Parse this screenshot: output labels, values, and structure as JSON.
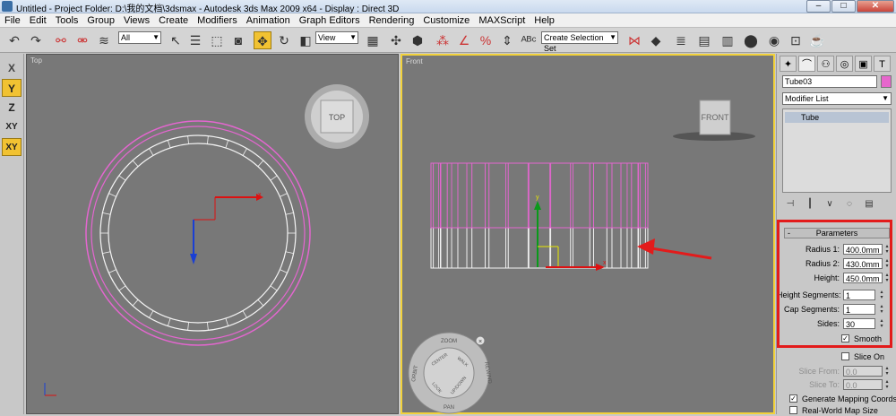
{
  "window": {
    "title": "Untitled      - Project Folder: D:\\我的文档\\3dsmax      - Autodesk 3ds Max  2009 x64      - Display : Direct 3D",
    "minimize": "–",
    "maximize": "□",
    "close": "✕"
  },
  "menu": [
    "File",
    "Edit",
    "Tools",
    "Group",
    "Views",
    "Create",
    "Modifiers",
    "Animation",
    "Graph Editors",
    "Rendering",
    "Customize",
    "MAXScript",
    "Help"
  ],
  "toolbar": {
    "selection_filter": "All",
    "reference_coord": "View",
    "named_selection_placeholder": "Create Selection Set"
  },
  "axis_constraints": [
    "X",
    "Y",
    "Z",
    "XY",
    "XY"
  ],
  "viewports": {
    "top": {
      "label": "Top",
      "viewcube": "TOP"
    },
    "front": {
      "label": "Front",
      "viewcube": "FRONT"
    }
  },
  "steering_wheel": {
    "zoom": "ZOOM",
    "orbit": "ORBIT",
    "center": "CENTER",
    "walk": "WALK",
    "rewind": "REWIND",
    "look": "LOOK",
    "up_down": "UP/DOWN",
    "pan": "PAN"
  },
  "gizmo": {
    "x": "x",
    "y": "y"
  },
  "command_panel": {
    "object_name": "Tube03",
    "object_color": "#e666cc",
    "modifier_list": "Modifier List",
    "stack_item": "Tube",
    "rollout_title": "Parameters",
    "rollout_toggle": "-",
    "params": [
      {
        "label": "Radius 1:",
        "value": "400.0mm"
      },
      {
        "label": "Radius 2:",
        "value": "430.0mm"
      },
      {
        "label": "Height:",
        "value": "450.0mm"
      },
      {
        "label": "Height Segments:",
        "value": "1"
      },
      {
        "label": "Cap Segments:",
        "value": "1"
      },
      {
        "label": "Sides:",
        "value": "30"
      }
    ],
    "smooth": "Smooth",
    "smooth_checked": true,
    "slice_on": "Slice On",
    "slice_from": {
      "label": "Slice From:",
      "value": "0.0"
    },
    "slice_to": {
      "label": "Slice To:",
      "value": "0.0"
    },
    "gen_mapping": "Generate Mapping Coords.",
    "real_world": "Real-World Map Size",
    "check_mark": "✓"
  },
  "colors": {
    "viewport_bg": "#787878",
    "active_border": "#f2d23b",
    "highlight": "#e31b1b",
    "tube_wire": "#e466d0"
  }
}
